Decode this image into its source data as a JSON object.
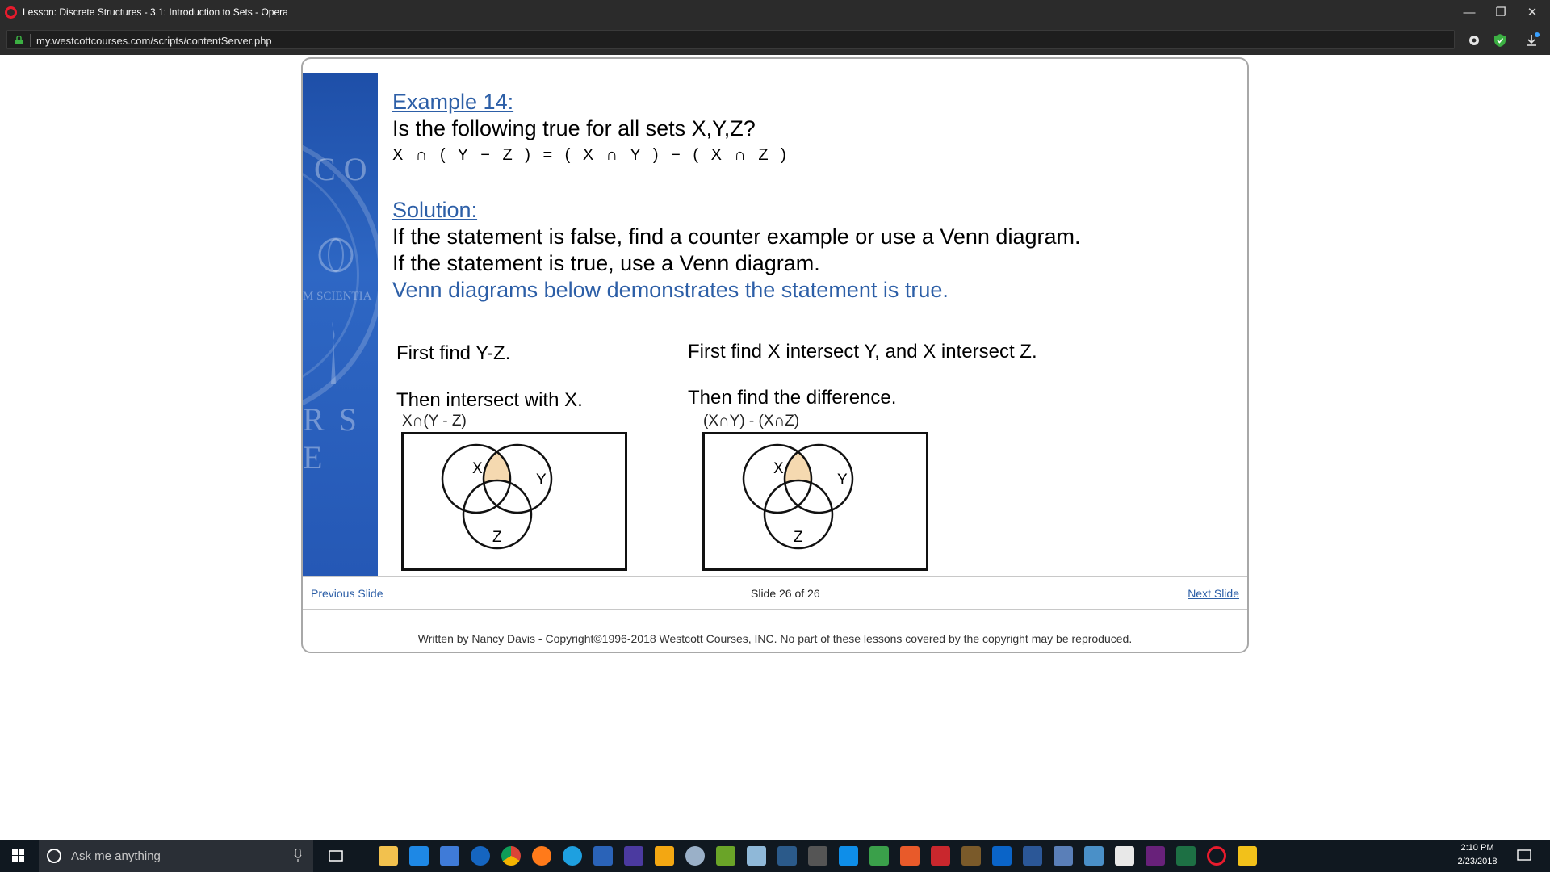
{
  "window": {
    "title": "Lesson: Discrete Structures - 3.1: Introduction to Sets - Opera",
    "minimize_glyph": "—",
    "restore_glyph": "❐",
    "close_glyph": "✕"
  },
  "addressbar": {
    "url": "my.westcottcourses.com/scripts/contentServer.php",
    "icons": [
      "lock-icon",
      "settings-gear-icon",
      "shield-icon",
      "download-icon"
    ]
  },
  "slide": {
    "seal_text_top": "C O",
    "seal_text_mid": "M SCIENTIA",
    "seal_text_bottom": "R S E",
    "example_heading": "Example 14:",
    "question": "Is the following true for all sets X,Y,Z?",
    "formula": "X ∩ ( Y − Z )  =  ( X ∩ Y ) − ( X ∩ Z )",
    "solution_heading": "Solution:",
    "line1": "If the statement is false, find a counter example or use a Venn diagram.",
    "line2": "If the statement is true, use a Venn diagram.",
    "line3": "Venn diagrams below demonstrates the statement is true.",
    "left": {
      "step1": "First find Y-Z.",
      "step2": "Then intersect with X.",
      "caption": "X∩(Y - Z)",
      "labels": {
        "x": "X",
        "y": "Y",
        "z": "Z"
      }
    },
    "right": {
      "step1": "First find X intersect Y, and X intersect Z.",
      "step2": "Then find the difference.",
      "caption": "(X∩Y) - (X∩Z)",
      "labels": {
        "x": "X",
        "y": "Y",
        "z": "Z"
      }
    },
    "shade_color": "#f5d9b0"
  },
  "nav": {
    "previous": "Previous Slide",
    "counter": "Slide 26 of 26",
    "next": "Next Slide"
  },
  "footer": "Written by Nancy Davis - Copyright©1996-2018 Westcott Courses, INC. No part of these lessons covered by the copyright may be reproduced.",
  "taskbar": {
    "search_placeholder": "Ask me anything",
    "time": "2:10 PM",
    "date": "2/23/2018",
    "apps": [
      "task-view-icon",
      "file-explorer-icon",
      "store-icon",
      "xamarin-icon",
      "edge-icon",
      "chrome-icon",
      "firefox-icon",
      "ie-icon",
      "powershell-icon",
      "dp-icon",
      "favorites-star-icon",
      "paint-icon",
      "lambda-icon",
      "notes-icon",
      "network-icon",
      "calculator-icon",
      "teamviewer-icon",
      "camtasia-icon",
      "puzzle-icon",
      "filezilla-icon",
      "media-icon",
      "outlook-icon",
      "word-icon",
      "network-share-icon",
      "remote-desktop-icon",
      "mail-icon",
      "visual-studio-icon",
      "excel-icon",
      "opera-icon",
      "sticky-icon"
    ]
  }
}
